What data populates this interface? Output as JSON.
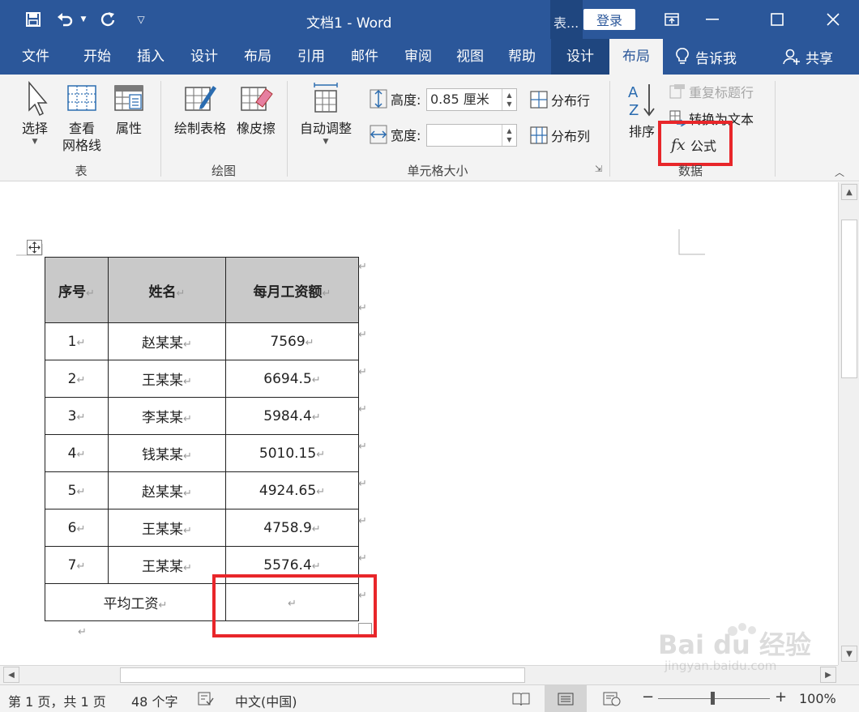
{
  "title_bar": {
    "doc_title": "文档1  -  Word",
    "context_title": "表...",
    "login_label": "登录"
  },
  "tabs": [
    {
      "label": "文件"
    },
    {
      "label": "开始"
    },
    {
      "label": "插入"
    },
    {
      "label": "设计"
    },
    {
      "label": "布局"
    },
    {
      "label": "引用"
    },
    {
      "label": "邮件"
    },
    {
      "label": "审阅"
    },
    {
      "label": "视图"
    },
    {
      "label": "帮助"
    },
    {
      "label": "设计"
    },
    {
      "label": "布局"
    }
  ],
  "tell_me": "告诉我",
  "share": "共享",
  "ribbon": {
    "table_group": {
      "label": "表",
      "select": "选择",
      "gridlines_1": "查看",
      "gridlines_2": "网格线",
      "properties": "属性"
    },
    "draw_group": {
      "label": "绘图",
      "draw_table": "绘制表格",
      "eraser": "橡皮擦"
    },
    "cell_size_group": {
      "label": "单元格大小",
      "autofit": "自动调整",
      "height_label": "高度:",
      "height_value": "0.85 厘米",
      "width_label": "宽度:",
      "width_value": "",
      "distribute_rows": "分布行",
      "distribute_cols": "分布列"
    },
    "data_group": {
      "label": "数据",
      "sort": "排序",
      "repeat_header": "重复标题行",
      "convert_to_text": "转换为文本",
      "formula": "公式"
    }
  },
  "table": {
    "headers": [
      "序号",
      "姓名",
      "每月工资额"
    ],
    "rows": [
      [
        "1",
        "赵某某",
        "7569"
      ],
      [
        "2",
        "王某某",
        "6694.5"
      ],
      [
        "3",
        "李某某",
        "5984.4"
      ],
      [
        "4",
        "钱某某",
        "5010.15"
      ],
      [
        "5",
        "赵某某",
        "4924.65"
      ],
      [
        "6",
        "王某某",
        "4758.9"
      ],
      [
        "7",
        "王某某",
        "5576.4"
      ]
    ],
    "footer_label": "平均工资",
    "footer_value": ""
  },
  "paragraph_mark": "↵",
  "status_bar": {
    "page": "第 1 页，共 1 页",
    "words": "48 个字",
    "language": "中文(中国)",
    "zoom": "100%"
  },
  "watermark": {
    "logo": "Bai du 经验",
    "url": "jingyan.baidu.com"
  },
  "colors": {
    "word_blue": "#2b579a",
    "context_tab": "#1f467f",
    "highlight_red": "#e8262a",
    "header_fill": "#c9c9c9"
  }
}
